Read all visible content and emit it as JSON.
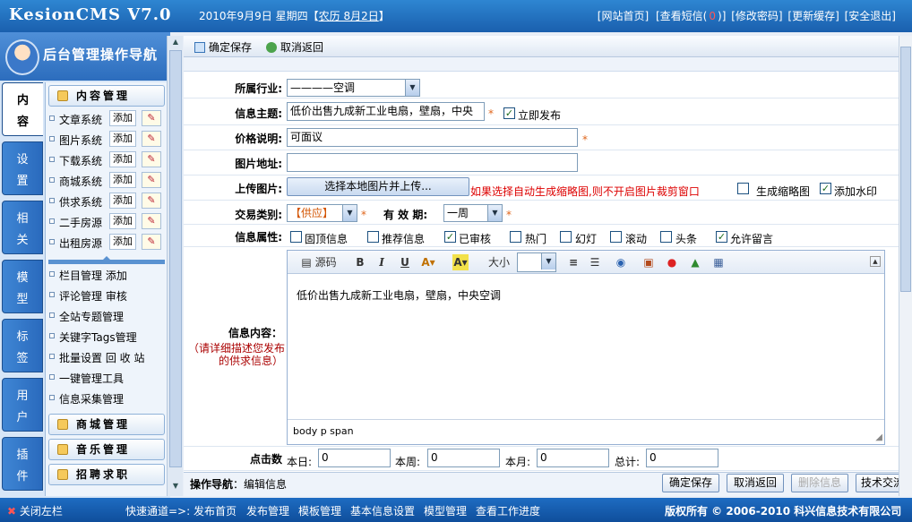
{
  "header": {
    "logo": "KesionCMS V7.0",
    "date": "2010年9月9日 星期四【",
    "lunar_link": "农历 8月2日",
    "date_end": "】",
    "links": [
      "[网站首页]",
      "[查看短信(",
      ")]",
      "[修改密码]",
      "[更新缓存]",
      "[安全退出]"
    ],
    "msg_count": "0"
  },
  "sidebar": {
    "title": "后台管理操作导航",
    "vtabs": [
      {
        "line1": "内",
        "line2": "容"
      },
      {
        "line1": "设",
        "line2": "置"
      },
      {
        "line1": "相",
        "line2": "关"
      },
      {
        "line1": "模",
        "line2": "型"
      },
      {
        "line1": "标",
        "line2": "签"
      },
      {
        "line1": "用",
        "line2": "户"
      },
      {
        "line1": "插",
        "line2": "件"
      }
    ],
    "section_head": "内容管理",
    "items": [
      {
        "label": "文章系统",
        "add": "添加"
      },
      {
        "label": "图片系统",
        "add": "添加"
      },
      {
        "label": "下载系统",
        "add": "添加"
      },
      {
        "label": "商城系统",
        "add": "添加"
      },
      {
        "label": "供求系统",
        "add": "添加"
      },
      {
        "label": "二手房源",
        "add": "添加"
      },
      {
        "label": "出租房源",
        "add": "添加"
      }
    ],
    "links": [
      "栏目管理 添加",
      "评论管理 审核",
      "全站专题管理",
      "关键字Tags管理",
      "批量设置 回 收 站",
      "一键管理工具",
      "信息采集管理"
    ],
    "bottom_heads": [
      "商城管理",
      "音乐管理",
      "招聘求职"
    ]
  },
  "toolbar": {
    "save": "确定保存",
    "cancel": "取消返回"
  },
  "form": {
    "industry_label": "所属行业:",
    "industry_value": "————空调",
    "subject_label": "信息主题:",
    "subject_value": "低价出售九成新工业电扇，壁扇，中央",
    "publish_now": "立即发布",
    "price_label": "价格说明:",
    "price_value": "可面议",
    "image_label": "图片地址:",
    "upload_label": "上传图片:",
    "upload_button": "选择本地图片并上传...",
    "upload_hint": "如果选择自动生成缩略图,则不开启图片裁剪窗口",
    "thumb_label": "生成缩略图",
    "watermark_label": "添加水印",
    "type_label": "交易类别:",
    "type_value": "【供应】",
    "validity_label": "有 效 期:",
    "validity_value": "一周",
    "attr_label": "信息属性:",
    "attrs": [
      {
        "label": "固顶信息",
        "checked": false
      },
      {
        "label": "推荐信息",
        "checked": false
      },
      {
        "label": "已审核",
        "checked": true
      },
      {
        "label": "热门",
        "checked": false
      },
      {
        "label": "幻灯",
        "checked": false
      },
      {
        "label": "滚动",
        "checked": false
      },
      {
        "label": "头条",
        "checked": false
      },
      {
        "label": "允许留言",
        "checked": true
      }
    ],
    "content_label": "信息内容：",
    "content_hint1": "（请详细描述您发布",
    "content_hint2": "的供求信息）",
    "editor_source": "源码",
    "editor_size": "大小",
    "editor_text": "低价出售九成新工业电扇，壁扇，中央空调",
    "editor_path": "body  p  span",
    "clicks_label": "点击数",
    "today": "本日:",
    "today_val": "0",
    "week": "本周:",
    "week_val": "0",
    "month": "本月:",
    "month_val": "0",
    "total": "总计:",
    "total_val": "0"
  },
  "footer": {
    "nav_label": "操作导航",
    "nav_value": "：编辑信息",
    "buttons": [
      "确定保存",
      "取消返回",
      "删除信息",
      "技术交流"
    ]
  },
  "bottombar": {
    "close_left": "关闭左栏",
    "quick": "快速通道=>:",
    "links": [
      "发布首页",
      "发布管理",
      "模板管理",
      "基本信息设置",
      "模型管理",
      "查看工作进度"
    ],
    "copyright": "版权所有 © 2006-2010 科兴信息技术有限公司"
  }
}
